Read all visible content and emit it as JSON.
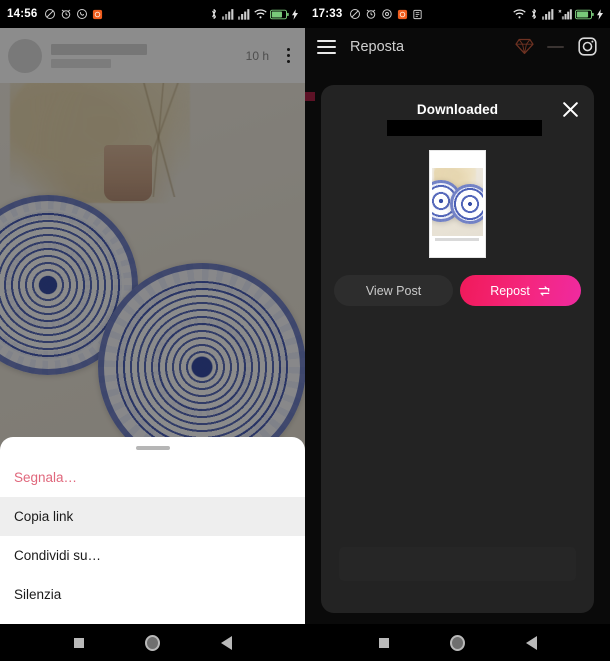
{
  "left_phone": {
    "status_bar": {
      "time": "14:56",
      "icons_left": [
        "mute-icon",
        "alarm-icon",
        "whatsapp-icon",
        "orange-app-icon"
      ],
      "icons_right": [
        "bluetooth-icon",
        "signal-1-icon",
        "signal-2-icon",
        "wifi-icon",
        "battery-charging-icon"
      ]
    },
    "instagram_post": {
      "timestamp": "10 h",
      "username_redacted": true,
      "menu_icon": "three-dots-icon",
      "photo_alt": "blue and white patterned ceramic plates with dried flowers"
    },
    "action_sheet": {
      "handle": true,
      "items": [
        {
          "label": "Segnala…",
          "style": "danger",
          "pressed": false
        },
        {
          "label": "Copia link",
          "style": "normal",
          "pressed": true
        },
        {
          "label": "Condividi su…",
          "style": "normal",
          "pressed": false
        },
        {
          "label": "Silenzia",
          "style": "normal",
          "pressed": false
        }
      ]
    },
    "nav_bar": {
      "recents": "square-icon",
      "home": "circle-icon",
      "back": "triangle-back-icon"
    }
  },
  "right_phone": {
    "status_bar": {
      "time": "17:33",
      "icons_left": [
        "mute-icon",
        "alarm-icon",
        "sync-icon",
        "orange-app-icon",
        "document-icon"
      ],
      "icons_right": [
        "wifi-icon",
        "bluetooth-icon",
        "signal-1-icon",
        "signal-2-icon",
        "battery-charging-icon"
      ]
    },
    "app_bar": {
      "menu_icon": "hamburger-menu-icon",
      "title": "Reposta",
      "premium_icon": "diamond-icon",
      "dash_icon": "dash-icon",
      "instagram_icon": "instagram-icon"
    },
    "dialog": {
      "title": "Downloaded",
      "close_icon": "close-icon",
      "redacted_bar": true,
      "thumbnail_alt": "downloaded post thumbnail of blue and white plates",
      "buttons": {
        "view_post": "View Post",
        "repost": "Repost",
        "repost_icon": "repeat-icon"
      }
    },
    "nav_bar": {
      "recents": "square-icon",
      "home": "circle-icon",
      "back": "triangle-back-icon"
    }
  },
  "colors": {
    "repost_pink": "#f5267e",
    "danger_red": "#e0677c",
    "dialog_bg": "#232323",
    "app_bg": "#0a0a0a",
    "sheet_bg": "#ffffff",
    "pressed_bg": "#eeeeee"
  }
}
